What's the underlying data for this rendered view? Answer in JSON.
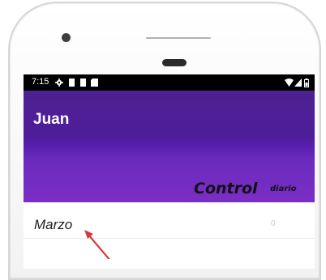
{
  "status_bar": {
    "time": "7:15",
    "icons": [
      "settings-icon",
      "notification-icon",
      "notification-icon",
      "download-icon",
      "wifi-icon",
      "signal-icon",
      "battery-icon"
    ]
  },
  "app_bar": {
    "title": "Juan",
    "banner_main": "Control",
    "banner_sub": "diario",
    "gradient_colors": [
      "#4d2191",
      "#7b2ec6"
    ]
  },
  "list": {
    "items": [
      {
        "label": "Marzo",
        "count": "0"
      }
    ]
  },
  "annotation": {
    "arrow_color": "#d33a3a"
  }
}
